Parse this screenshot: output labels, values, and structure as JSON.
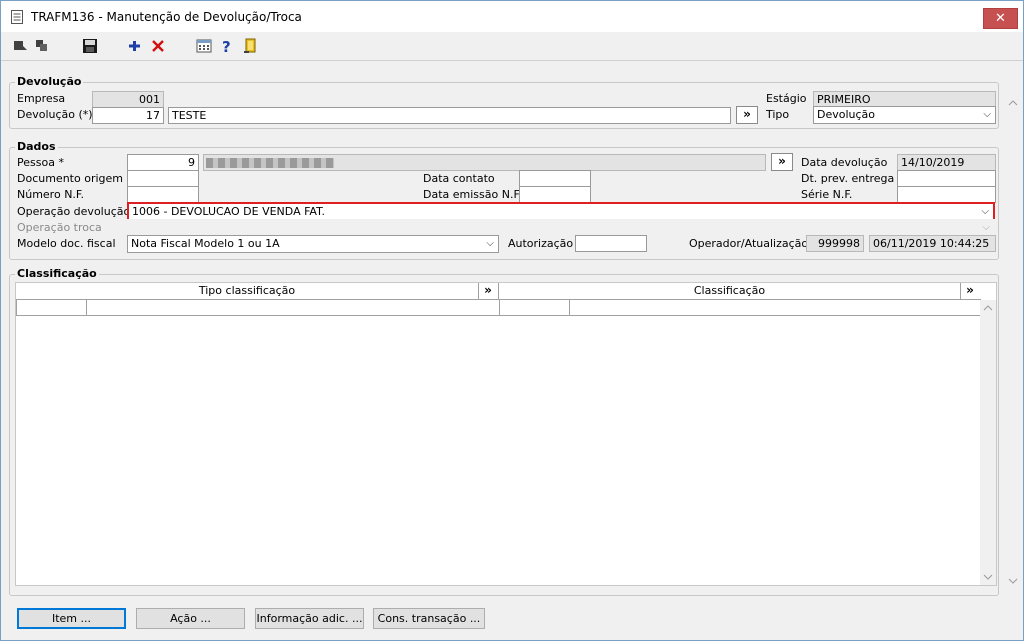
{
  "window": {
    "title": "TRAFM136 - Manutenção de Devolução/Troca",
    "close_label": "✕"
  },
  "toolbar": {
    "icons": [
      "first-record-icon",
      "next-record-icon",
      "save-icon",
      "add-icon",
      "delete-icon",
      "calculator-icon",
      "help-icon",
      "exit-door-icon"
    ]
  },
  "devolucao": {
    "group_label": "Devolução",
    "empresa_label": "Empresa",
    "empresa_value": "001",
    "devolucao_label": "Devolução (*)",
    "devolucao_number": "17",
    "devolucao_desc": "TESTE",
    "lookup_label": "»",
    "estagio_label": "Estágio",
    "estagio_value": "PRIMEIRO",
    "tipo_label": "Tipo",
    "tipo_value": "Devolução"
  },
  "dados": {
    "group_label": "Dados",
    "pessoa_label": "Pessoa *",
    "pessoa_code": "9",
    "pessoa_name": "",
    "pessoa_lookup": "»",
    "data_devolucao_label": "Data devolução",
    "data_devolucao_value": "14/10/2019",
    "documento_origem_label": "Documento origem",
    "data_contato_label": "Data contato",
    "dt_prev_entrega_label": "Dt. prev. entrega",
    "numero_nf_label": "Número N.F.",
    "data_emissao_nf_label": "Data emissão N.F.",
    "serie_nf_label": "Série N.F.",
    "operacao_devolucao_label": "Operação devolução",
    "operacao_devolucao_value": "1006 - DEVOLUCAO DE VENDA FAT.",
    "operacao_troca_label": "Operação troca",
    "modelo_doc_label": "Modelo doc. fiscal",
    "modelo_doc_value": "Nota Fiscal Modelo 1 ou 1A",
    "autorizacao_label": "Autorização",
    "operador_label": "Operador/Atualização",
    "operador_code": "999998",
    "operador_datetime": "06/11/2019 10:44:25"
  },
  "classificacao": {
    "group_label": "Classificação",
    "col_tipo": "Tipo classificação",
    "col_classificacao": "Classificação",
    "col_btn": "»"
  },
  "buttons": {
    "item": "Item ...",
    "acao": "Ação ...",
    "informacao": "Informação adic. ...",
    "cons_transacao": "Cons. transação ..."
  },
  "colors": {
    "highlight_border": "#e02020",
    "close_bg": "#c75050"
  }
}
